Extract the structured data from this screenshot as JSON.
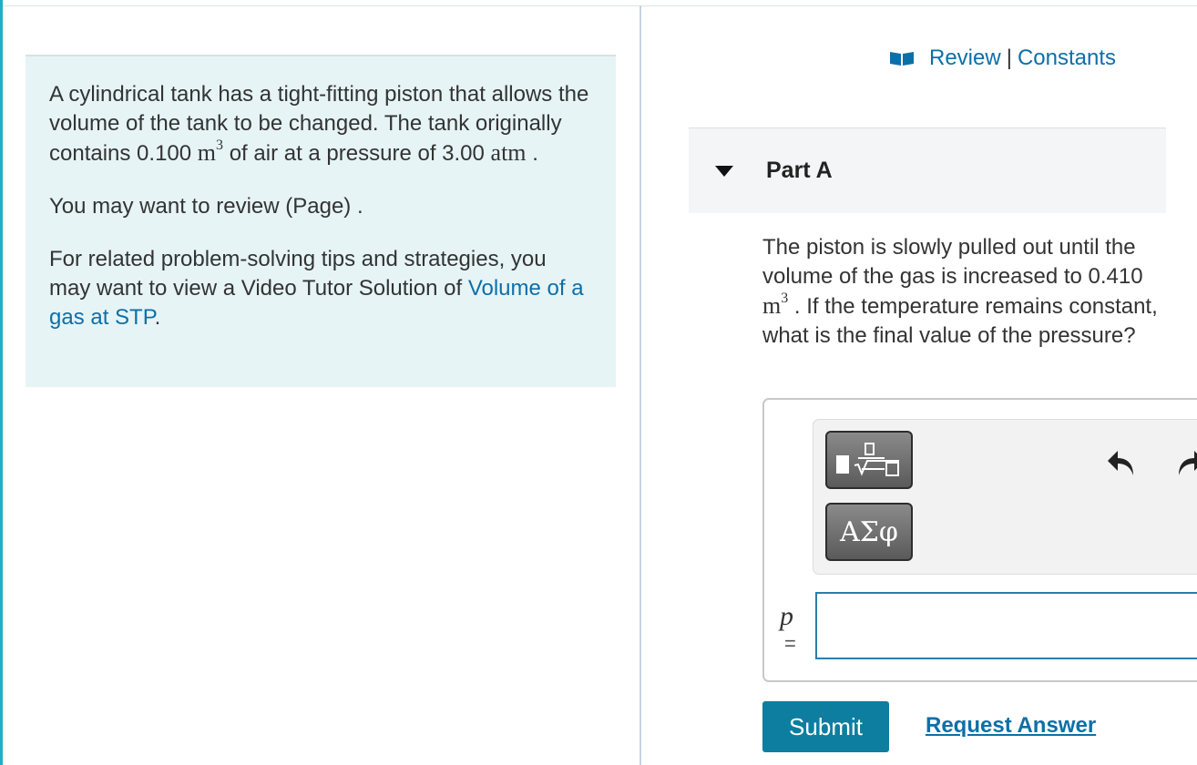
{
  "intro": {
    "p1_before": "A cylindrical tank has a tight-fitting piston that allows the volume of the tank to be changed. The tank originally contains 0.100 ",
    "p1_unit1": "m",
    "p1_exp1": "3",
    "p1_middle": " of air at a pressure of 3.00 ",
    "p1_unit2": "atm",
    "p1_end": " .",
    "p2": "You may want to review (Page) .",
    "p3_before": "For related problem-solving tips and strategies, you may want to view a Video Tutor Solution of ",
    "p3_link": "Volume of a gas at STP",
    "p3_end": "."
  },
  "header_links": {
    "icon": "book-icon",
    "review": "Review",
    "separator": "|",
    "constants": "Constants"
  },
  "part": {
    "title": "Part A",
    "caret_icon": "caret-down-icon"
  },
  "question": {
    "before": "The piston is slowly pulled out until the volume of the gas is increased to 0.410 ",
    "unit": "m",
    "exp": "3",
    "after": " . If the temperature remains constant, what is the final value of the pressure?"
  },
  "toolbar": {
    "templates_icon": "templates-icon",
    "greek_label": "ΑΣφ",
    "undo_icon": "undo-icon",
    "redo_icon": "redo-icon"
  },
  "answer": {
    "variable": "p",
    "equals": "=",
    "value": ""
  },
  "actions": {
    "submit": "Submit",
    "request_answer": "Request Answer"
  },
  "colors": {
    "accent": "#1cb0c7",
    "link": "#0d6fa8",
    "submit_bg": "#0d7ea0",
    "intro_bg": "#e6f4f6"
  }
}
